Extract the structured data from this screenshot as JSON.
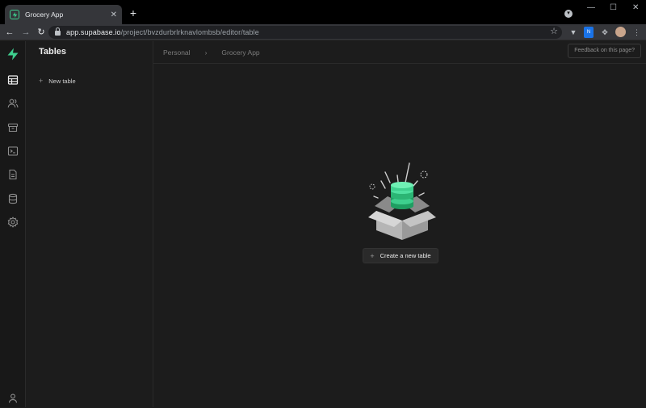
{
  "browser": {
    "tab_title": "Grocery App",
    "tab_close": "✕",
    "new_tab": "+",
    "url_host": "app.supabase.io",
    "url_path": "/project/bvzdurbrlrknavlombsb/editor/table",
    "window_controls": [
      "—",
      "☐",
      "✕"
    ]
  },
  "sidebar": {
    "title": "Tables",
    "new_table_label": "New table"
  },
  "rail": {
    "icons": [
      "table-editor-icon",
      "users-icon",
      "storage-icon",
      "sql-terminal-icon",
      "docs-icon",
      "database-icon",
      "settings-icon",
      "account-icon"
    ],
    "brand_color": "#3ecf8e"
  },
  "header": {
    "breadcrumb_org": "Personal",
    "breadcrumb_sep": "›",
    "breadcrumb_project": "Grocery App",
    "feedback_label": "Feedback on this page?"
  },
  "empty_state": {
    "create_label": "Create a new table",
    "accent_color": "#3ecf8e"
  }
}
